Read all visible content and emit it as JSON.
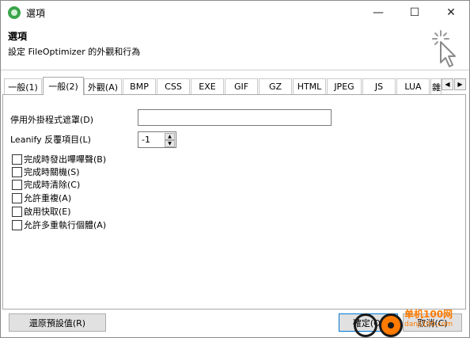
{
  "window": {
    "title": "選項",
    "controls": {
      "minimize": "—",
      "maximize": "☐",
      "close": "✕"
    }
  },
  "header": {
    "title": "選項",
    "subtitle": "設定 FileOptimizer 的外觀和行為"
  },
  "tabs": [
    {
      "label": "一般(1)",
      "active": false
    },
    {
      "label": "一般(2)",
      "active": true
    },
    {
      "label": "外觀(A)",
      "active": false
    },
    {
      "label": "BMP",
      "active": false
    },
    {
      "label": "CSS",
      "active": false
    },
    {
      "label": "EXE",
      "active": false
    },
    {
      "label": "GIF",
      "active": false
    },
    {
      "label": "GZ",
      "active": false
    },
    {
      "label": "HTML",
      "active": false
    },
    {
      "label": "JPEG",
      "active": false
    },
    {
      "label": "JS",
      "active": false
    },
    {
      "label": "LUA",
      "active": false
    },
    {
      "label": "雜項",
      "active": false
    }
  ],
  "tab_scroll": {
    "left": "◀",
    "right": "▶"
  },
  "form": {
    "mask_label": "停用外掛程式遮罩(D)",
    "mask_value": "",
    "leanify_label": "Leanify 反覆項目(L)",
    "leanify_value": "-1",
    "spin_up": "▲",
    "spin_down": "▼"
  },
  "checkboxes": [
    {
      "label": "完成時發出嗶嗶聲(B)",
      "checked": false
    },
    {
      "label": "完成時關機(S)",
      "checked": false
    },
    {
      "label": "完成時清除(C)",
      "checked": false
    },
    {
      "label": "允許重複(A)",
      "checked": false
    },
    {
      "label": "啟用快取(E)",
      "checked": false
    },
    {
      "label": "允許多重執行個體(A)",
      "checked": false
    }
  ],
  "buttons": {
    "restore_defaults": "還原預設值(R)",
    "ok": "確定(O)",
    "cancel": "取消(C)"
  },
  "watermark": {
    "text": "单机100网",
    "url": "danji100.com"
  }
}
